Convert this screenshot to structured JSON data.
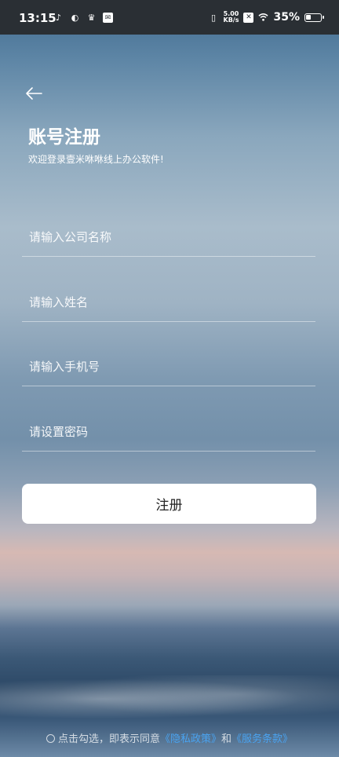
{
  "status_bar": {
    "time": "13:15",
    "net_speed_value": "5.00",
    "net_speed_unit": "KB/s",
    "battery_percent": "35%",
    "battery_level": 0.35
  },
  "header": {
    "title": "账号注册",
    "subtitle": "欢迎登录壹米咻咻线上办公软件!"
  },
  "form": {
    "company_placeholder": "请输入公司名称",
    "name_placeholder": "请输入姓名",
    "phone_placeholder": "请输入手机号",
    "password_placeholder": "请设置密码",
    "submit_label": "注册"
  },
  "agreement": {
    "prefix": "点击勾选，即表示同意",
    "privacy_link": "《隐私政策》",
    "connector": "和",
    "terms_link": "《服务条款》"
  },
  "colors": {
    "link": "#4aa3f0",
    "button_bg": "#ffffff"
  }
}
